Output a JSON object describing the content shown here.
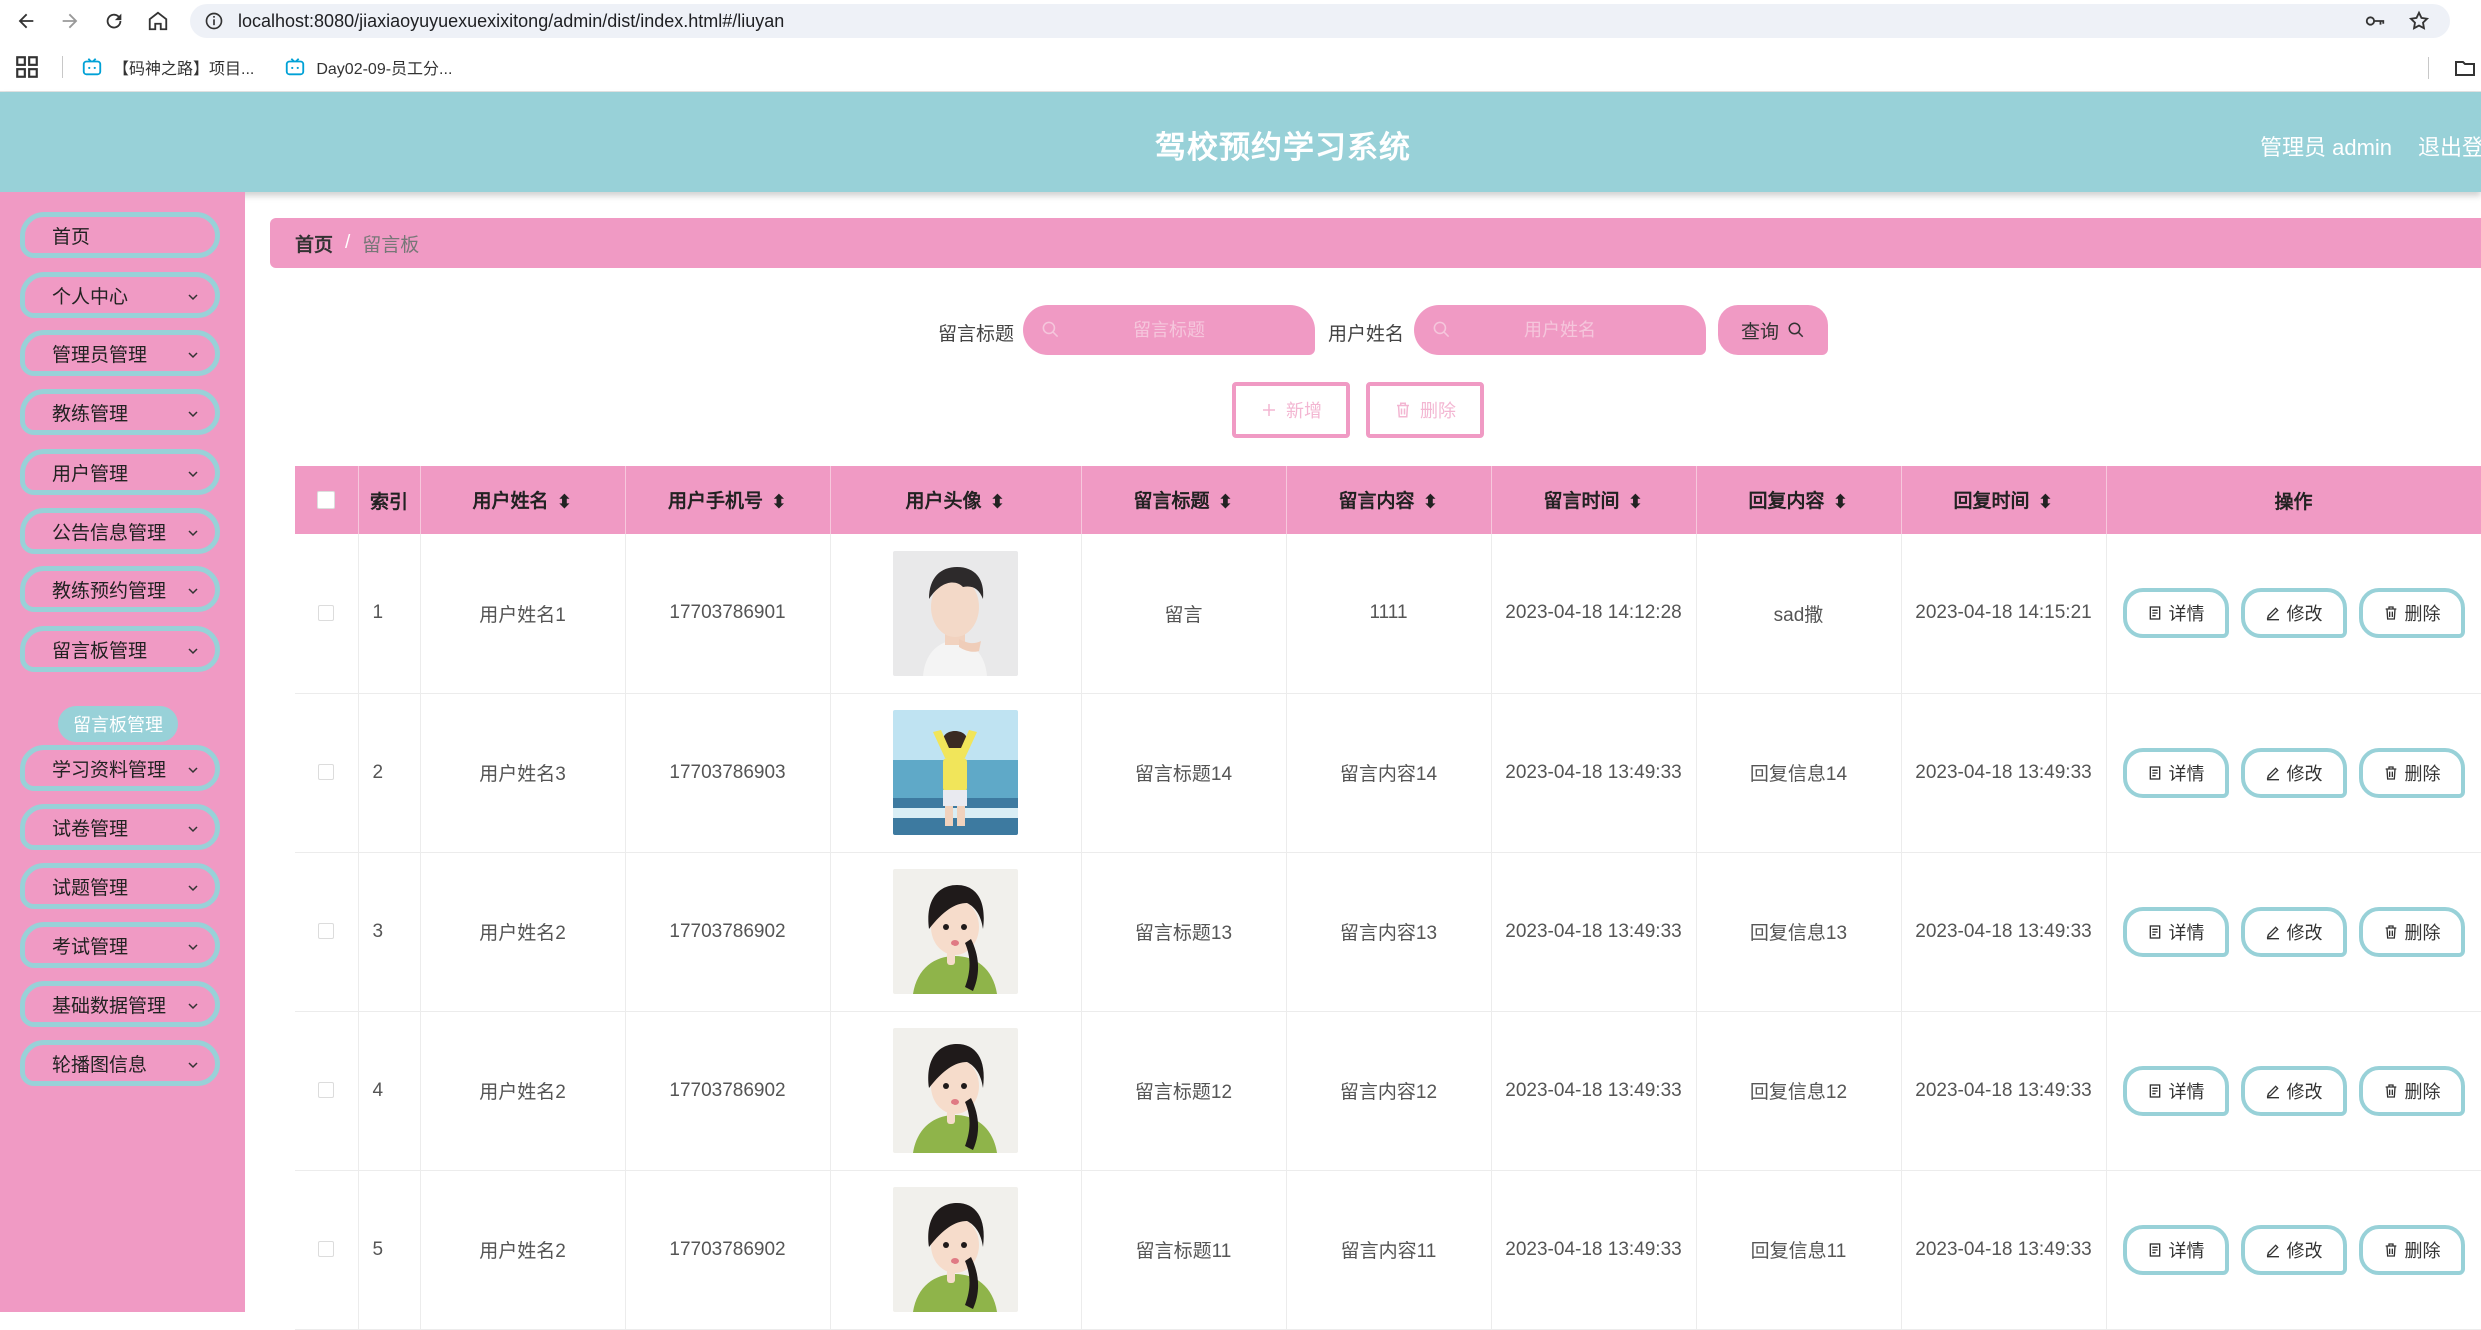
{
  "browser": {
    "url": "localhost:8080/jiaxiaoyuyuexuexixitong/admin/dist/index.html#/liuyan",
    "bookmarks": [
      "【码神之路】项目...",
      "Day02-09-员工分..."
    ]
  },
  "header": {
    "title": "驾校预约学习系统",
    "user": "管理员 admin",
    "logout": "退出登录"
  },
  "sidebar": {
    "items": [
      {
        "label": "首页",
        "expandable": false
      },
      {
        "label": "个人中心",
        "expandable": true
      },
      {
        "label": "管理员管理",
        "expandable": true
      },
      {
        "label": "教练管理",
        "expandable": true
      },
      {
        "label": "用户管理",
        "expandable": true
      },
      {
        "label": "公告信息管理",
        "expandable": true
      },
      {
        "label": "教练预约管理",
        "expandable": true
      },
      {
        "label": "留言板管理",
        "expandable": true
      },
      {
        "label": "学习资料管理",
        "expandable": true
      },
      {
        "label": "试卷管理",
        "expandable": true
      },
      {
        "label": "试题管理",
        "expandable": true
      },
      {
        "label": "考试管理",
        "expandable": true
      },
      {
        "label": "基础数据管理",
        "expandable": true
      },
      {
        "label": "轮播图信息",
        "expandable": true
      }
    ],
    "active_sub": "留言板管理"
  },
  "breadcrumb": {
    "home": "首页",
    "separator": "/",
    "current": "留言板"
  },
  "search": {
    "title_label": "留言标题",
    "title_placeholder": "留言标题",
    "name_label": "用户姓名",
    "name_placeholder": "用户姓名",
    "query_button": "查询"
  },
  "actions": {
    "add": "新增",
    "delete": "删除"
  },
  "table": {
    "headers": [
      "索引",
      "用户姓名",
      "用户手机号",
      "用户头像",
      "留言标题",
      "留言内容",
      "留言时间",
      "回复内容",
      "回复时间",
      "操作"
    ],
    "rows": [
      {
        "index": "1",
        "name": "用户姓名1",
        "phone": "17703786901",
        "avatar": "male-avatar",
        "title": "留言",
        "content": "1111",
        "time": "2023-04-18 14:12:28",
        "reply": "sad撒",
        "reply_time": "2023-04-18 14:15:21"
      },
      {
        "index": "2",
        "name": "用户姓名3",
        "phone": "17703786903",
        "avatar": "seaside-avatar",
        "title": "留言标题14",
        "content": "留言内容14",
        "time": "2023-04-18 13:49:33",
        "reply": "回复信息14",
        "reply_time": "2023-04-18 13:49:33"
      },
      {
        "index": "3",
        "name": "用户姓名2",
        "phone": "17703786902",
        "avatar": "girl-avatar",
        "title": "留言标题13",
        "content": "留言内容13",
        "time": "2023-04-18 13:49:33",
        "reply": "回复信息13",
        "reply_time": "2023-04-18 13:49:33"
      },
      {
        "index": "4",
        "name": "用户姓名2",
        "phone": "17703786902",
        "avatar": "girl-avatar",
        "title": "留言标题12",
        "content": "留言内容12",
        "time": "2023-04-18 13:49:33",
        "reply": "回复信息12",
        "reply_time": "2023-04-18 13:49:33"
      },
      {
        "index": "5",
        "name": "用户姓名2",
        "phone": "17703786902",
        "avatar": "girl-avatar",
        "title": "留言标题11",
        "content": "留言内容11",
        "time": "2023-04-18 13:49:33",
        "reply": "回复信息11",
        "reply_time": "2023-04-18 13:49:33"
      }
    ],
    "row_actions": {
      "detail": "详情",
      "edit": "修改",
      "delete": "删除"
    }
  },
  "colors": {
    "header_bg": "#98d1d8",
    "pink": "#f09ac4",
    "teal_border": "#98d1d8"
  }
}
